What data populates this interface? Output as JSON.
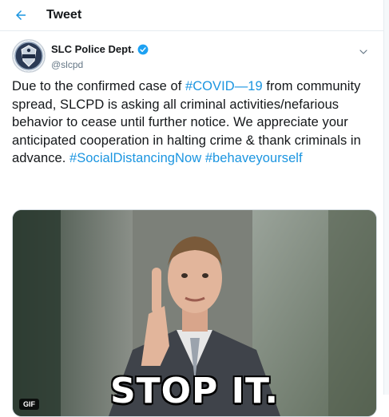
{
  "header": {
    "title": "Tweet",
    "back_icon": "arrow-left-icon"
  },
  "tweet": {
    "author": {
      "display_name": "SLC Police Dept.",
      "handle": "@slcpd",
      "verified": true
    },
    "text_parts": [
      "Due to the confirmed case of ",
      "#COVID—19",
      " from community spread, SLCPD is asking all criminal activities/nefarious behavior to cease until further notice. We appreciate your anticipated cooperation in halting crime & thank criminals in advance. ",
      "#SocialDistancingNow",
      " ",
      "#behaveyourself"
    ],
    "media": {
      "badge": "GIF",
      "caption": "STOP IT."
    }
  },
  "colors": {
    "accent": "#1b95e0",
    "text": "#14171a",
    "secondary": "#657786"
  }
}
